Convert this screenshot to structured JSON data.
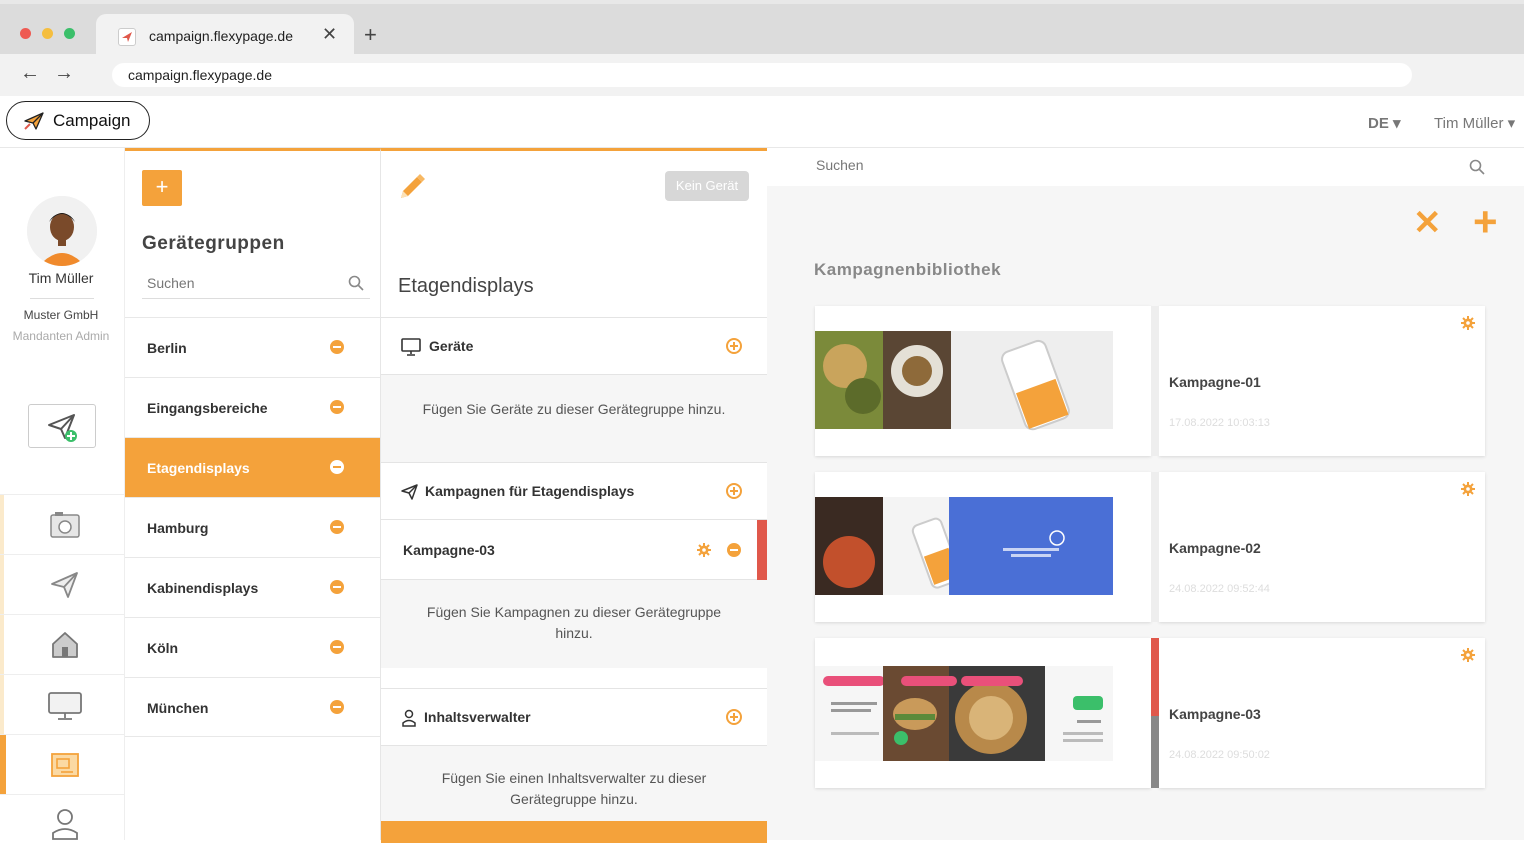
{
  "browser": {
    "tab_title": "campaign.flexypage.de",
    "tab_close": "✕",
    "new_tab": "+",
    "back": "←",
    "forward": "→",
    "url": "campaign.flexypage.de"
  },
  "header": {
    "brand": "Campaign",
    "language": "DE ▾",
    "user_menu": "Tim Müller ▾"
  },
  "rail": {
    "user_name": "Tim Müller",
    "organization": "Muster GmbH",
    "role": "Mandanten Admin"
  },
  "groups": {
    "add_label": "+",
    "title": "Gerätegruppen",
    "search_placeholder": "Suchen",
    "items": [
      {
        "label": "Berlin"
      },
      {
        "label": "Eingangsbereiche"
      },
      {
        "label": "Etagendisplays"
      },
      {
        "label": "Hamburg"
      },
      {
        "label": "Kabinendisplays"
      },
      {
        "label": "Köln"
      },
      {
        "label": "München"
      }
    ]
  },
  "detail": {
    "no_device_button": "Kein Gerät",
    "title": "Etagendisplays",
    "devices_header": "Geräte",
    "devices_empty": "Fügen Sie Geräte zu dieser Gerätegruppe hinzu.",
    "campaigns_header": "Kampagnen für Etagendisplays",
    "campaign_row": "Kampagne-03",
    "campaigns_empty": "Fügen Sie Kampagnen zu dieser Gerätegruppe hinzu.",
    "managers_header": "Inhaltsverwalter",
    "managers_empty": "Fügen Sie einen Inhaltsverwalter zu dieser Gerätegruppe hinzu."
  },
  "library": {
    "search_placeholder": "Suchen",
    "close_label": "✕",
    "add_label": "+",
    "title": "Kampagnenbibliothek",
    "campaigns": [
      {
        "name": "Kampagne-01",
        "date": "17.08.2022 10:03:13"
      },
      {
        "name": "Kampagne-02",
        "date": "24.08.2022 09:52:44"
      },
      {
        "name": "Kampagne-03",
        "date": "24.08.2022 09:50:02"
      }
    ]
  },
  "colors": {
    "accent": "#f4a23b",
    "danger": "#e0584b",
    "preview_blue": "#4a6fd6"
  }
}
